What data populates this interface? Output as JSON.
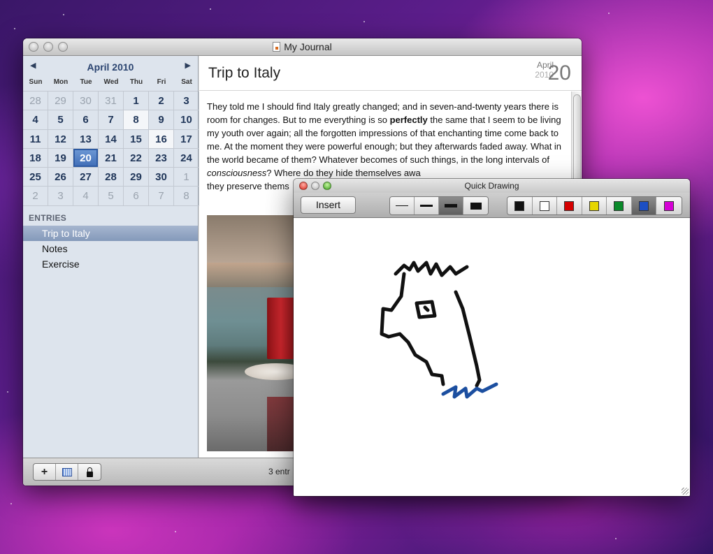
{
  "main_window": {
    "title": "My Journal",
    "calendar": {
      "month_label": "April 2010",
      "prev_arrow": "◀",
      "next_arrow": "▶",
      "weekdays": [
        "Sun",
        "Mon",
        "Tue",
        "Wed",
        "Thu",
        "Fri",
        "Sat"
      ],
      "weeks": [
        [
          "28",
          "29",
          "30",
          "31",
          "1",
          "2",
          "3"
        ],
        [
          "4",
          "5",
          "6",
          "7",
          "8",
          "9",
          "10"
        ],
        [
          "11",
          "12",
          "13",
          "14",
          "15",
          "16",
          "17"
        ],
        [
          "18",
          "19",
          "20",
          "21",
          "22",
          "23",
          "24"
        ],
        [
          "25",
          "26",
          "27",
          "28",
          "29",
          "30",
          "1"
        ],
        [
          "2",
          "3",
          "4",
          "5",
          "6",
          "7",
          "8"
        ]
      ],
      "selected_day": "20"
    },
    "entries": {
      "header": "ENTRIES",
      "items": [
        "Trip to Italy",
        "Notes",
        "Exercise"
      ],
      "selected": "Trip to Italy"
    },
    "entry": {
      "title": "Trip to Italy",
      "date_month": "April",
      "date_year": "2010",
      "date_day": "20",
      "body_1": "They told me I should find Italy greatly changed; and in seven-and-twenty years there is room for changes.  But to me everything is so ",
      "body_bold": "perfectly",
      "body_2": " the same that I seem to be living my youth over again; all the forgotten impressions of that enchanting time come back to me.  At the moment they were powerful enough; but they afterwards faded away.  What in the world became of them?  Whatever becomes of such things, in the long intervals of ",
      "body_italic": "consciousness",
      "body_3": "?  Where do they hide themselves awa",
      "body_4": "they preserve thems"
    },
    "bottom_bar": {
      "add_label": "+",
      "entries_count": "3 entr"
    }
  },
  "quick_drawing": {
    "title": "Quick Drawing",
    "insert_label": "Insert",
    "stroke_widths": [
      "thin",
      "medium",
      "thick",
      "extra-thick"
    ],
    "selected_stroke": "thick",
    "colors": [
      "#111111",
      "#ffffff",
      "#d40000",
      "#e6d600",
      "#0a8a2a",
      "#1c4fc4",
      "#d400d4"
    ],
    "selected_color": "#1c4fc4"
  }
}
